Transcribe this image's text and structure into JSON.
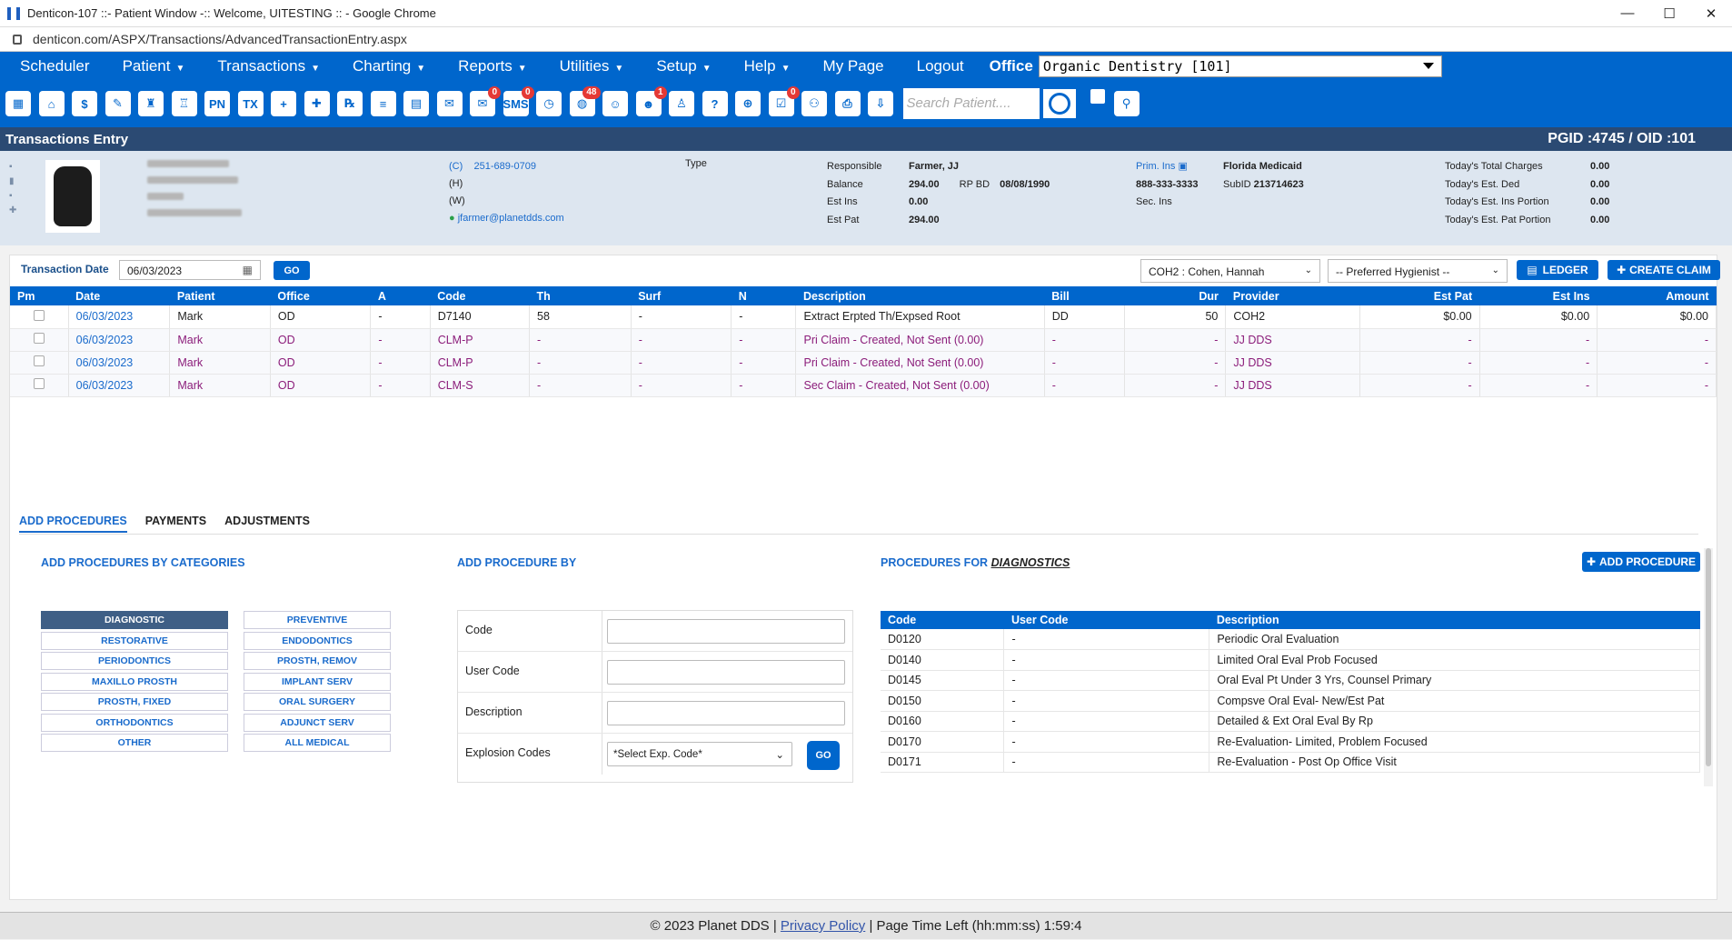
{
  "window": {
    "title": "Denticon-107 ::- Patient Window -:: Welcome, UITESTING :: - Google Chrome",
    "url": "denticon.com/ASPX/Transactions/AdvancedTransactionEntry.aspx",
    "minimize": "—",
    "maximize": "☐",
    "close": "✕"
  },
  "menu": {
    "items": [
      "Scheduler",
      "Patient",
      "Transactions",
      "Charting",
      "Reports",
      "Utilities",
      "Setup",
      "Help",
      "My Page",
      "Logout"
    ],
    "office_label": "Office",
    "office_value": "Organic Dentistry [101]"
  },
  "toolbar": {
    "badges": {
      "messages": "0",
      "sms": "0",
      "globe": "48",
      "alert": "1",
      "doc": "0"
    },
    "search_placeholder": "Search Patient....",
    "sms_label": "SMS",
    "pn_label": "PN",
    "tx_label": "TX"
  },
  "section": {
    "title": "Transactions Entry",
    "pgid": "PGID :4745  /  OID :101"
  },
  "patient": {
    "phone_c_label": "(C)",
    "phone_c": "251-689-0709",
    "phone_h_label": "(H)",
    "phone_w_label": "(W)",
    "email": "jfarmer@planetdds.com",
    "type_label": "Type",
    "responsible_label": "Responsible",
    "responsible": "Farmer, JJ",
    "balance_label": "Balance",
    "balance": "294.00",
    "rp_bd_label": "RP BD",
    "rp_bd": "08/08/1990",
    "est_ins_label": "Est Ins",
    "est_ins": "0.00",
    "est_pat_label": "Est Pat",
    "est_pat": "294.00",
    "prim_ins_label": "Prim. Ins",
    "prim_ins": "Florida Medicaid",
    "ins_phone": "888-333-3333",
    "subid_label": "SubID",
    "subid": "213714623",
    "sec_ins_label": "Sec. Ins",
    "today_total_label": "Today's Total Charges",
    "today_total": "0.00",
    "today_ded_label": "Today's Est. Ded",
    "today_ded": "0.00",
    "today_ins_label": "Today's Est. Ins Portion",
    "today_ins": "0.00",
    "today_pat_label": "Today's Est. Pat Portion",
    "today_pat": "0.00"
  },
  "filters": {
    "date_label": "Transaction Date",
    "date_value": "06/03/2023",
    "go": "GO",
    "provider": "COH2 : Cohen, Hannah",
    "hygienist": "-- Preferred Hygienist --",
    "ledger": "LEDGER",
    "create_claim": "CREATE CLAIM"
  },
  "transactions": {
    "headers": [
      "Pm",
      "Date",
      "Patient",
      "Office",
      "A",
      "Code",
      "Th",
      "Surf",
      "N",
      "Description",
      "Bill",
      "Dur",
      "Provider",
      "Est Pat",
      "Est Ins",
      "Amount"
    ],
    "rows": [
      [
        "",
        "06/03/2023",
        "Mark",
        "OD",
        "-",
        "D7140",
        "58",
        "-",
        "-",
        "Extract Erpted Th/Expsed Root",
        "DD",
        "50",
        "COH2",
        "$0.00",
        "$0.00",
        "$0.00"
      ],
      [
        "",
        "06/03/2023",
        "Mark",
        "OD",
        "-",
        "CLM-P",
        "-",
        "-",
        "-",
        "Pri Claim - Created, Not Sent (0.00)",
        "-",
        "-",
        "JJ DDS",
        "-",
        "-",
        "-"
      ],
      [
        "",
        "06/03/2023",
        "Mark",
        "OD",
        "-",
        "CLM-P",
        "-",
        "-",
        "-",
        "Pri Claim - Created, Not Sent (0.00)",
        "-",
        "-",
        "JJ DDS",
        "-",
        "-",
        "-"
      ],
      [
        "",
        "06/03/2023",
        "Mark",
        "OD",
        "-",
        "CLM-S",
        "-",
        "-",
        "-",
        "Sec Claim - Created, Not Sent (0.00)",
        "-",
        "-",
        "JJ DDS",
        "-",
        "-",
        "-"
      ]
    ]
  },
  "tabs": [
    "ADD PROCEDURES",
    "PAYMENTS",
    "ADJUSTMENTS"
  ],
  "categories": {
    "heading": "ADD PROCEDURES BY CATEGORIES",
    "left": [
      "DIAGNOSTIC",
      "RESTORATIVE",
      "PERIODONTICS",
      "MAXILLO PROSTH",
      "PROSTH, FIXED",
      "ORTHODONTICS",
      "OTHER"
    ],
    "right": [
      "PREVENTIVE",
      "ENDODONTICS",
      "PROSTH, REMOV",
      "IMPLANT SERV",
      "ORAL SURGERY",
      "ADJUNCT SERV",
      "ALL MEDICAL"
    ]
  },
  "add_by": {
    "heading": "ADD PROCEDURE BY",
    "code": "Code",
    "user_code": "User Code",
    "description": "Description",
    "explosion": "Explosion Codes",
    "explosion_value": "*Select Exp. Code*",
    "go": "GO"
  },
  "procedures": {
    "heading": "PROCEDURES FOR",
    "category": "DIAGNOSTICS",
    "add_button": "ADD PROCEDURE",
    "headers": [
      "Code",
      "User Code",
      "Description"
    ],
    "rows": [
      [
        "D0120",
        "-",
        "Periodic Oral Evaluation"
      ],
      [
        "D0140",
        "-",
        "Limited Oral Eval Prob Focused"
      ],
      [
        "D0145",
        "-",
        "Oral Eval Pt Under 3 Yrs, Counsel Primary"
      ],
      [
        "D0150",
        "-",
        "Compsve Oral Eval- New/Est Pat"
      ],
      [
        "D0160",
        "-",
        "Detailed & Ext Oral Eval By Rp"
      ],
      [
        "D0170",
        "-",
        "Re-Evaluation- Limited, Problem Focused"
      ],
      [
        "D0171",
        "-",
        "Re-Evaluation - Post Op Office Visit"
      ]
    ]
  },
  "footer": {
    "copyright": "© 2023 Planet DDS |",
    "privacy": "Privacy Policy",
    "time_left": "| Page Time Left (hh:mm:ss) 1:59:4"
  }
}
